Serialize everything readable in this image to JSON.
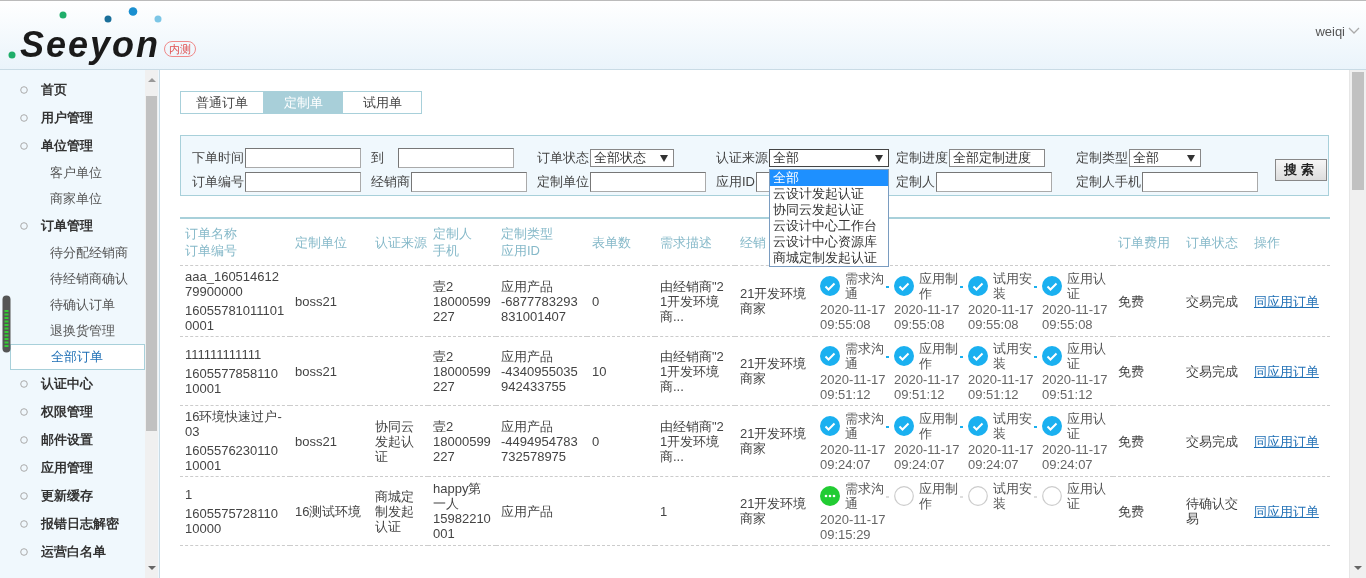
{
  "header": {
    "logo": "Seeyon",
    "badge": "内测",
    "user": "weiqi"
  },
  "sidebar": {
    "items": [
      {
        "label": "首页",
        "selected": false
      },
      {
        "label": "用户管理",
        "selected": false
      },
      {
        "label": "单位管理",
        "selected": false,
        "children": [
          {
            "label": "客户单位",
            "selected": false
          },
          {
            "label": "商家单位",
            "selected": false
          }
        ]
      },
      {
        "label": "订单管理",
        "selected": false,
        "children": [
          {
            "label": "待分配经销商",
            "selected": false
          },
          {
            "label": "待经销商确认",
            "selected": false
          },
          {
            "label": "待确认订单",
            "selected": false
          },
          {
            "label": "退换货管理",
            "selected": false
          },
          {
            "label": "全部订单",
            "selected": true
          }
        ]
      },
      {
        "label": "认证中心",
        "selected": false
      },
      {
        "label": "权限管理",
        "selected": false
      },
      {
        "label": "邮件设置",
        "selected": false
      },
      {
        "label": "应用管理",
        "selected": false
      },
      {
        "label": "更新缓存",
        "selected": false
      },
      {
        "label": "报错日志解密",
        "selected": false
      },
      {
        "label": "运营白名单",
        "selected": false
      }
    ]
  },
  "tabs": [
    {
      "label": "普通订单",
      "selected": false
    },
    {
      "label": "定制单",
      "selected": true
    },
    {
      "label": "试用单",
      "selected": false
    }
  ],
  "filters": {
    "rows": [
      [
        {
          "label": "下单时间",
          "kind": "input"
        },
        {
          "label": "到",
          "kind": "input"
        },
        {
          "label": "订单状态",
          "kind": "select",
          "value": "全部状态",
          "expanded": false
        },
        {
          "label": "认证来源",
          "kind": "select",
          "value": "全部",
          "expanded": true,
          "options": [
            {
              "label": "全部",
              "selected": true
            },
            {
              "label": "云设计发起认证",
              "selected": false
            },
            {
              "label": "协同云发起认证",
              "selected": false
            },
            {
              "label": "云设计中心工作台",
              "selected": false
            },
            {
              "label": "云设计中心资源库",
              "selected": false
            },
            {
              "label": "商城定制发起认证",
              "selected": false
            }
          ]
        },
        {
          "label": "定制进度",
          "kind": "select",
          "value": "全部定制进度",
          "expanded": false
        },
        {
          "label": "定制类型",
          "kind": "select",
          "value": "全部",
          "expanded": false
        }
      ],
      [
        {
          "label": "订单编号",
          "kind": "input"
        },
        {
          "label": "经销商",
          "kind": "input"
        },
        {
          "label": "定制单位",
          "kind": "input"
        },
        {
          "label": "应用ID",
          "kind": "input"
        },
        {
          "label": "定制人",
          "kind": "input"
        },
        {
          "label": "定制人手机",
          "kind": "input"
        }
      ]
    ],
    "search_button": "搜索"
  },
  "table": {
    "columns": [
      [
        "订单名称",
        "订单编号"
      ],
      [
        "定制单位"
      ],
      [
        "认证来源"
      ],
      [
        "定制人",
        "手机"
      ],
      [
        "定制类型",
        "应用ID"
      ],
      [
        "表单数"
      ],
      [
        "需求描述"
      ],
      [
        "经销"
      ],
      [
        "订单费用"
      ],
      [
        "订单状态"
      ],
      [
        "操作"
      ]
    ],
    "rows": [
      {
        "name": "aaa_16051461279900000",
        "number": "160557810111010001",
        "unit": "boss21",
        "owner": "壹2",
        "phone": "18000599227",
        "type": "应用产品",
        "app_id": "-6877783293831001407",
        "forms": "0",
        "description": "由经销商\"21开发环境商...",
        "dealer": "21开发环境商家",
        "steps": [
          {
            "label": "需求沟通",
            "kind": "done",
            "date": "2020-11-17",
            "time": "09:55:08"
          },
          {
            "label": "应用制作",
            "kind": "done",
            "date": "2020-11-17",
            "time": "09:55:08"
          },
          {
            "label": "试用安装",
            "kind": "done",
            "date": "2020-11-17",
            "time": "09:55:08"
          },
          {
            "label": "应用认证",
            "kind": "done",
            "date": "2020-11-17",
            "time": "09:55:08"
          }
        ],
        "fee": "免费",
        "status": "交易完成",
        "action": "同应用订单"
      },
      {
        "name": "111111111111",
        "number": "160557785811010001",
        "unit": "boss21",
        "owner": "壹2",
        "phone": "18000599227",
        "type": "应用产品",
        "app_id": "-4340955035942433755",
        "forms": "10",
        "description": "由经销商\"21开发环境商...",
        "dealer": "21开发环境商家",
        "steps": [
          {
            "label": "需求沟通",
            "kind": "done",
            "date": "2020-11-17",
            "time": "09:51:12"
          },
          {
            "label": "应用制作",
            "kind": "done",
            "date": "2020-11-17",
            "time": "09:51:12"
          },
          {
            "label": "试用安装",
            "kind": "done",
            "date": "2020-11-17",
            "time": "09:51:12"
          },
          {
            "label": "应用认证",
            "kind": "done",
            "date": "2020-11-17",
            "time": "09:51:12"
          }
        ],
        "fee": "免费",
        "status": "交易完成",
        "action": "同应用订单"
      },
      {
        "name": "16环境快速过户-03",
        "number": "160557623011010001",
        "unit": "boss21",
        "cert_source": "协同云发起认证",
        "owner": "壹2",
        "phone": "18000599227",
        "type": "应用产品",
        "app_id": "-4494954783732578975",
        "forms": "0",
        "description": "由经销商\"21开发环境商...",
        "dealer": "21开发环境商家",
        "steps": [
          {
            "label": "需求沟通",
            "kind": "done",
            "date": "2020-11-17",
            "time": "09:24:07"
          },
          {
            "label": "应用制作",
            "kind": "done",
            "date": "2020-11-17",
            "time": "09:24:07"
          },
          {
            "label": "试用安装",
            "kind": "done",
            "date": "2020-11-17",
            "time": "09:24:07"
          },
          {
            "label": "应用认证",
            "kind": "done",
            "date": "2020-11-17",
            "time": "09:24:07"
          }
        ],
        "fee": "免费",
        "status": "交易完成",
        "action": "同应用订单"
      },
      {
        "name": "1",
        "number": "160557572811010000",
        "unit": "16测试环境",
        "cert_source": "商城定制发起认证",
        "owner": "happy第一人",
        "phone": "15982210001",
        "type": "应用产品",
        "description": "1",
        "dealer": "21开发环境商家",
        "steps": [
          {
            "label": "需求沟通",
            "kind": "active",
            "date": "2020-11-17",
            "time": "09:15:29"
          },
          {
            "label": "应用制作",
            "kind": "pending"
          },
          {
            "label": "试用安装",
            "kind": "pending"
          },
          {
            "label": "应用认证",
            "kind": "pending"
          }
        ],
        "fee": "免费",
        "status": "待确认交易",
        "action": "同应用订单"
      }
    ]
  }
}
